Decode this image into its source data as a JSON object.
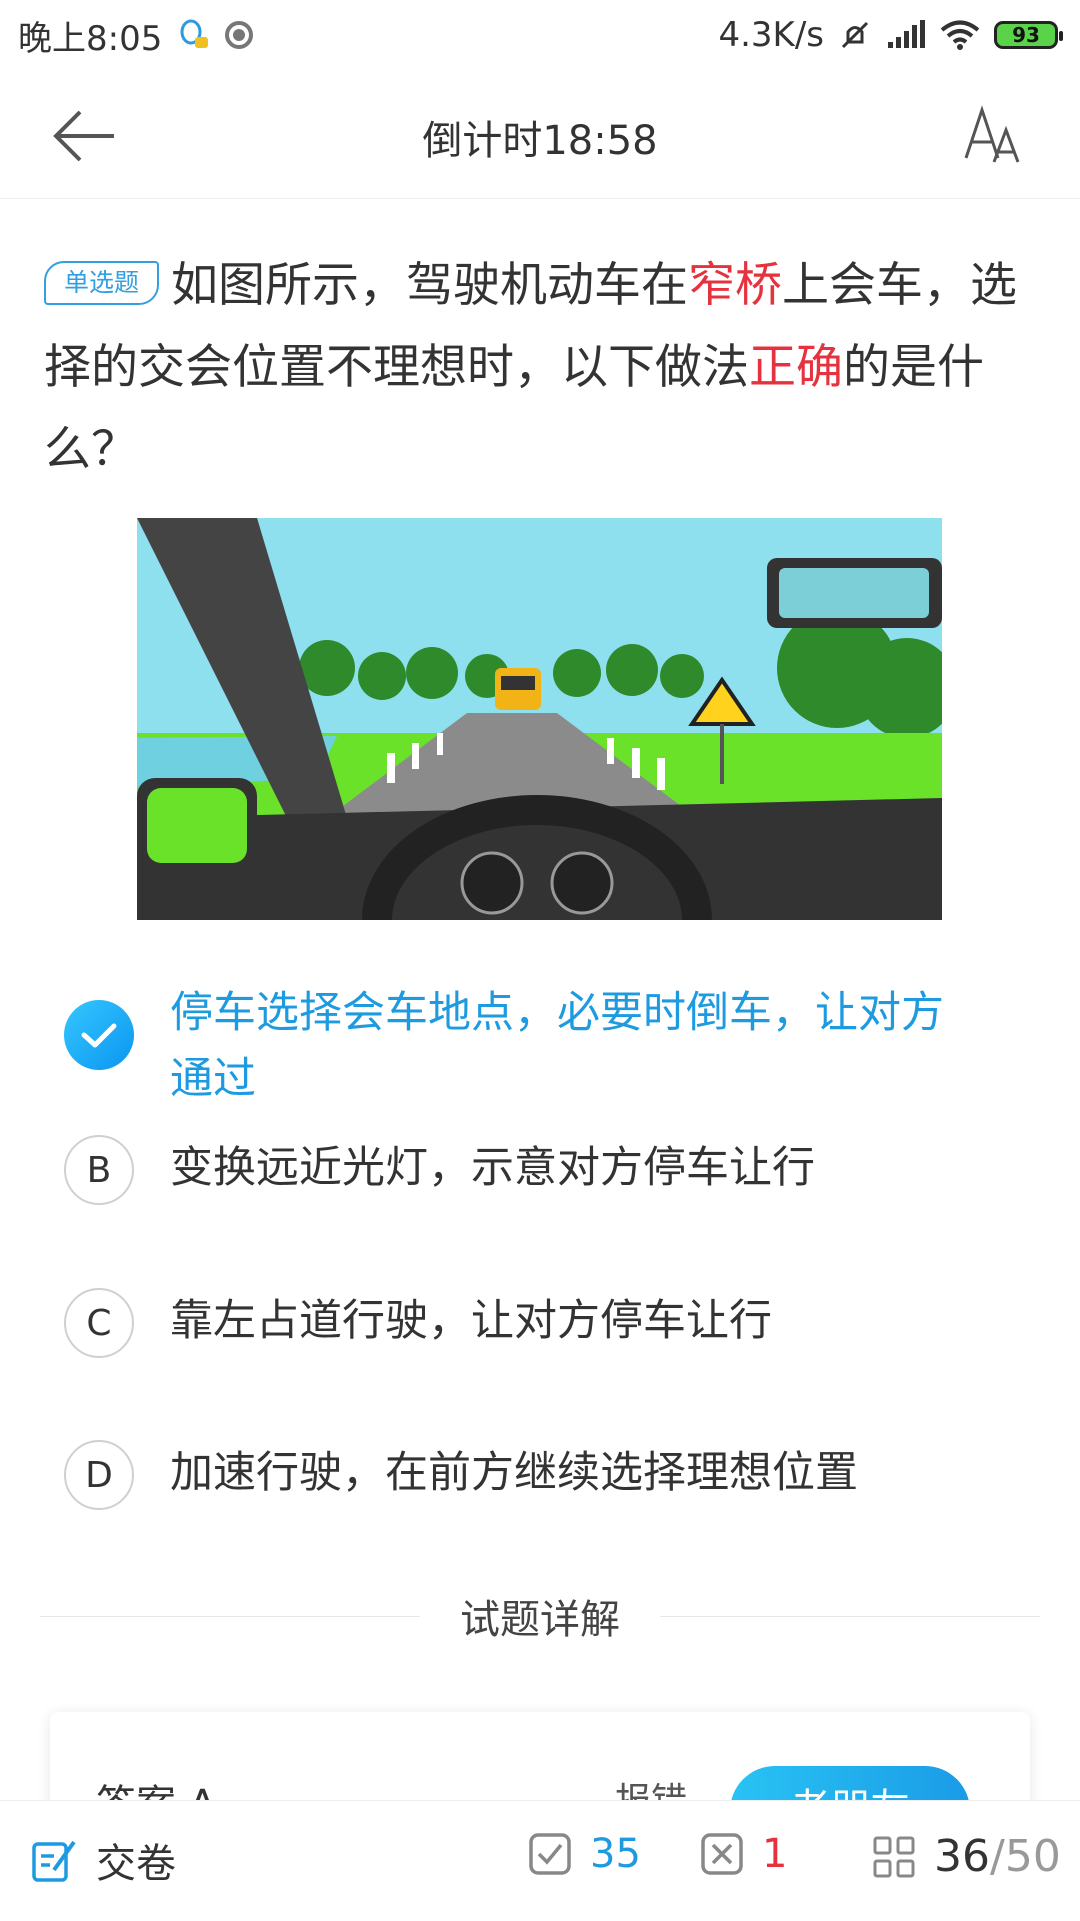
{
  "status_bar": {
    "time": "晚上8:05",
    "network_speed": "4.3K/s",
    "battery": "93"
  },
  "header": {
    "title": "倒计时18:58"
  },
  "question": {
    "type_badge": "单选题",
    "segments": [
      {
        "text": "如图所示，驾驶机动车在",
        "highlight": false
      },
      {
        "text": "窄桥",
        "highlight": true
      },
      {
        "text": "上会车，选择的交会位置不理想时，以下做法",
        "highlight": false
      },
      {
        "text": "正确",
        "highlight": true
      },
      {
        "text": "的是什么？",
        "highlight": false
      }
    ]
  },
  "options": [
    {
      "letter": "A",
      "text": "停车选择会车地点，必要时倒车，让对方通过",
      "selected": true
    },
    {
      "letter": "B",
      "text": "变换远近光灯，示意对方停车让行",
      "selected": false
    },
    {
      "letter": "C",
      "text": "靠左占道行驶，让对方停车让行",
      "selected": false
    },
    {
      "letter": "D",
      "text": "加速行驶，在前方继续选择理想位置",
      "selected": false
    }
  ],
  "detail": {
    "section_title": "试题详解",
    "answer_label": "答案  A",
    "report_label": "报错",
    "button_label": "老朋友"
  },
  "bottom_bar": {
    "submit_label": "交卷",
    "correct_count": "35",
    "wrong_count": "1",
    "current": "36",
    "total": "/50"
  },
  "colors": {
    "accent": "#1e9be0",
    "highlight": "#e6323e",
    "correct_icon": "#1e9be0",
    "wrong_icon": "#e6323e"
  }
}
